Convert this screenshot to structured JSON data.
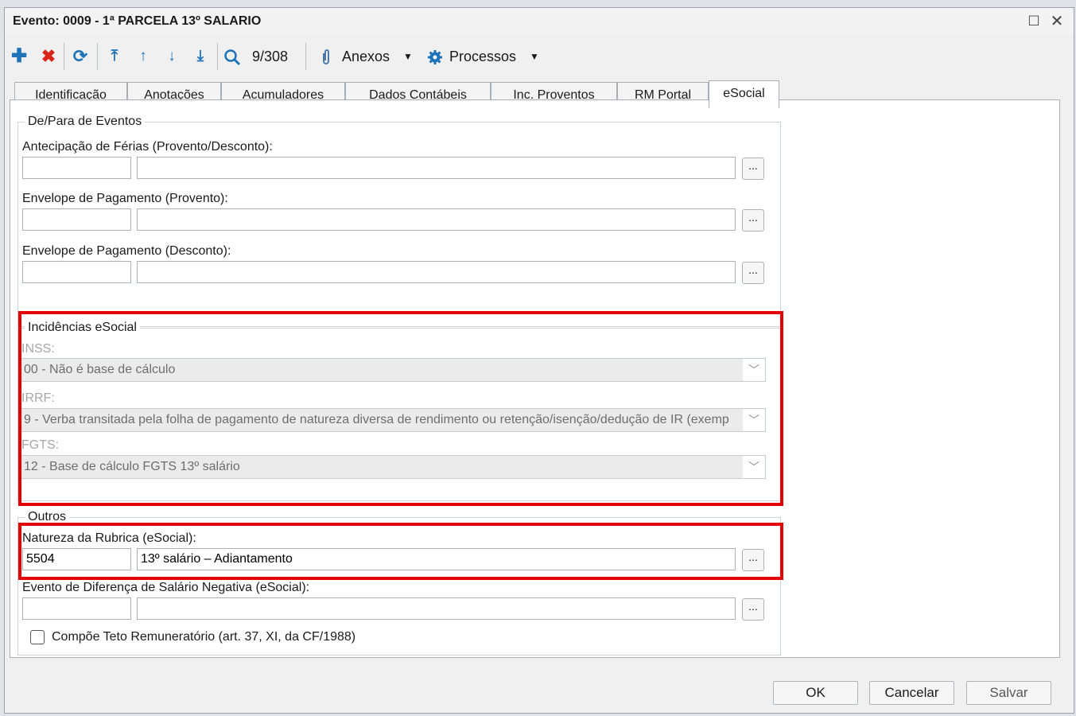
{
  "window": {
    "title": "Evento: 0009 - 1ª PARCELA 13º SALARIO"
  },
  "toolbar": {
    "record_position": "9/308",
    "anexos_label": "Anexos",
    "processos_label": "Processos"
  },
  "tabs": [
    "Identificação",
    "Anotações",
    "Acumuladores",
    "Dados Contábeis",
    "Inc. Proventos",
    "RM Portal",
    "eSocial"
  ],
  "active_tab": "eSocial",
  "depara": {
    "legend": "De/Para de Eventos",
    "antecipacao_label": "Antecipação de Férias (Provento/Desconto):",
    "envelope_provento_label": "Envelope de Pagamento (Provento):",
    "envelope_desconto_label": "Envelope de Pagamento (Desconto):",
    "lookup_button": "..."
  },
  "incidencias": {
    "legend": "Incidências eSocial",
    "inss_label": "INSS:",
    "inss_value": "00 - Não é base de cálculo",
    "irrf_label": "IRRF:",
    "irrf_value": "9 - Verba transitada pela folha de pagamento de natureza diversa de rendimento ou retenção/isenção/dedução de IR (exemp",
    "fgts_label": "FGTS:",
    "fgts_value": "12 - Base de cálculo FGTS 13º salário"
  },
  "outros": {
    "legend": "Outros",
    "natureza_label": "Natureza da Rubrica (eSocial):",
    "natureza_code": "5504",
    "natureza_desc": "13º salário – Adiantamento",
    "diferenca_label": "Evento de Diferença de Salário Negativa (eSocial):",
    "teto_label": "Compõe Teto Remuneratório (art. 37, XI, da CF/1988)"
  },
  "buttons": {
    "ok": "OK",
    "cancelar": "Cancelar",
    "salvar": "Salvar"
  },
  "colors": {
    "highlight": "#e20000",
    "icon_blue": "#1e73b9",
    "delete_red": "#d9261c"
  }
}
